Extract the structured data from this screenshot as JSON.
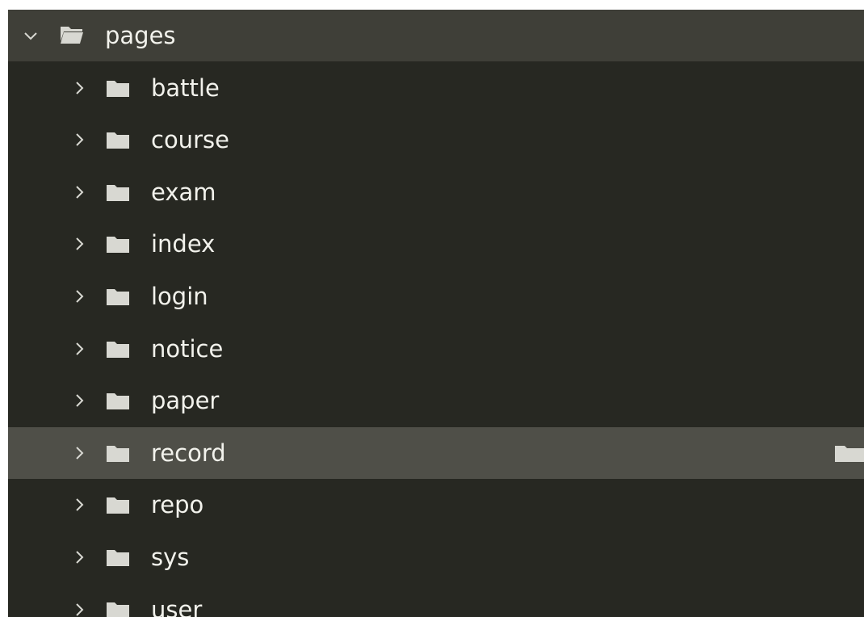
{
  "tree": {
    "root": {
      "label": "pages",
      "expanded": true,
      "icon": "folder-open-icon"
    },
    "children": [
      {
        "label": "battle",
        "icon": "folder-icon",
        "selected": false
      },
      {
        "label": "course",
        "icon": "folder-icon",
        "selected": false
      },
      {
        "label": "exam",
        "icon": "folder-icon",
        "selected": false
      },
      {
        "label": "index",
        "icon": "folder-icon",
        "selected": false
      },
      {
        "label": "login",
        "icon": "folder-icon",
        "selected": false
      },
      {
        "label": "notice",
        "icon": "folder-icon",
        "selected": false
      },
      {
        "label": "paper",
        "icon": "folder-icon",
        "selected": false
      },
      {
        "label": "record",
        "icon": "folder-icon",
        "selected": true
      },
      {
        "label": "repo",
        "icon": "folder-icon",
        "selected": false
      },
      {
        "label": "sys",
        "icon": "folder-icon",
        "selected": false
      },
      {
        "label": "user",
        "icon": "folder-icon",
        "selected": false
      }
    ]
  },
  "colors": {
    "panel_bg": "#272822",
    "root_row_bg": "#3f3f38",
    "selected_row_bg": "#4f4f48",
    "text": "#f2f2ec",
    "icon": "#d8d8d2"
  }
}
